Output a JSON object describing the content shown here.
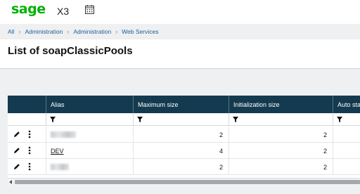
{
  "header": {
    "logo": "sage",
    "product": "X3",
    "calendar_icon": "calendar-icon"
  },
  "breadcrumb": [
    "All",
    "Administration",
    "Administration",
    "Web Services"
  ],
  "page": {
    "title": "List of soapClassicPools"
  },
  "grid": {
    "columns": [
      "Alias",
      "Maximum size",
      "Initialization size",
      "Auto sta"
    ],
    "rows": [
      {
        "alias": "",
        "maximum_size": "2",
        "initialization_size": "2"
      },
      {
        "alias": "DEV",
        "maximum_size": "4",
        "initialization_size": "2"
      },
      {
        "alias": "",
        "maximum_size": "2",
        "initialization_size": "2"
      }
    ]
  },
  "colors": {
    "header_bg": "#133a4f",
    "brand": "#00b000",
    "link": "#1d5f96"
  }
}
